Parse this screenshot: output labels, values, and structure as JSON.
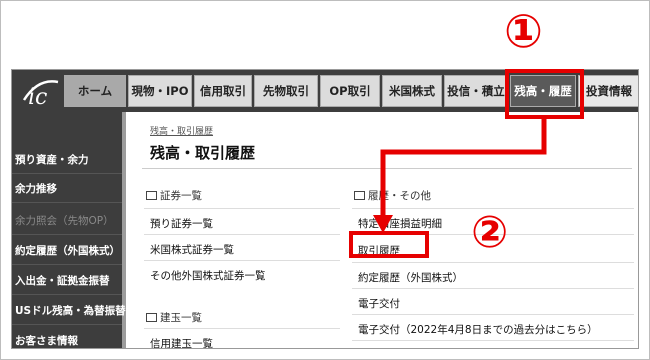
{
  "nav": {
    "logo_text": "ic",
    "tabs": [
      {
        "label": "ホーム"
      },
      {
        "label": "現物・IPO"
      },
      {
        "label": "信用取引"
      },
      {
        "label": "先物取引"
      },
      {
        "label": "OP取引"
      },
      {
        "label": "米国株式"
      },
      {
        "label": "投信・積立"
      },
      {
        "label": "残高・履歴"
      },
      {
        "label": "投資情報"
      }
    ]
  },
  "sidebar": {
    "items": [
      {
        "label": "預り資産・余力"
      },
      {
        "label": "余力推移"
      },
      {
        "label": "余力照会（先物OP）"
      },
      {
        "label": "約定履歴（外国株式）"
      },
      {
        "label": "入出金・証拠金振替"
      },
      {
        "label": "USドル残高・為替振替"
      },
      {
        "label": "お客さま情報"
      }
    ]
  },
  "main": {
    "breadcrumb": "残高・取引履歴",
    "title": "残高・取引履歴",
    "left_col": {
      "heading1": "証券一覧",
      "links1": [
        "預り証券一覧",
        "米国株式証券一覧",
        "その他外国株式証券一覧"
      ],
      "heading2": "建玉一覧",
      "links2": [
        "信用建玉一覧"
      ]
    },
    "right_col": {
      "heading": "履歴・その他",
      "links": [
        "特定口座損益明細",
        "取引履歴",
        "約定履歴（外国株式）",
        "電子交付",
        "電子交付（2022年4月8日までの過去分はこちら）"
      ]
    }
  },
  "annotations": {
    "step1": "①",
    "step2": "②",
    "color": "#e60000"
  }
}
